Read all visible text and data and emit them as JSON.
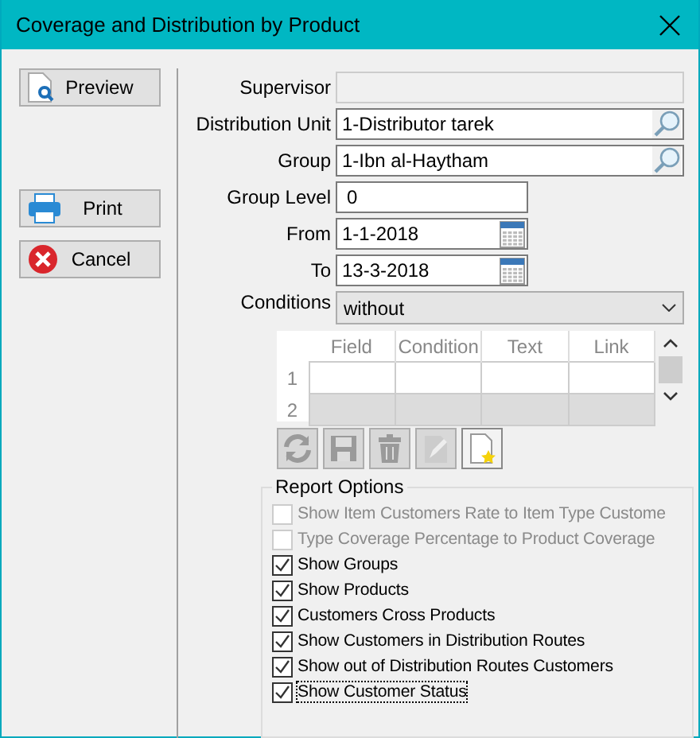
{
  "window": {
    "title": "Coverage and Distribution by Product"
  },
  "buttons": [
    {
      "label": "Preview",
      "kind": "preview"
    },
    {
      "label": "Print",
      "kind": "print"
    },
    {
      "label": "Cancel",
      "kind": "cancel"
    }
  ],
  "fields": [
    {
      "label": "Supervisor",
      "kind": "disabled"
    },
    {
      "label": "Distribution Unit",
      "value": "1-Distributor tarek",
      "kind": "lookup"
    },
    {
      "label": "Group",
      "value": "1-Ibn al-Haytham",
      "kind": "lookup"
    },
    {
      "label": "Group Level",
      "value": "0",
      "kind": "short"
    },
    {
      "label": "From",
      "value": "1-1-2018",
      "kind": "date"
    },
    {
      "label": "To",
      "value": "13-3-2018",
      "kind": "date"
    }
  ],
  "conditions": {
    "label": "Conditions",
    "value": "without"
  },
  "grid": {
    "columns": [
      "Field",
      "Condition",
      "Text",
      "Link"
    ],
    "rows": [
      {
        "number": "1",
        "disabled": false
      },
      {
        "number": "2",
        "disabled": true
      }
    ]
  },
  "toolbar": [
    {
      "kind": "refresh",
      "disabled": true
    },
    {
      "kind": "save",
      "disabled": true
    },
    {
      "kind": "delete",
      "disabled": true
    },
    {
      "kind": "edit",
      "disabled": true
    },
    {
      "kind": "new",
      "disabled": false
    }
  ],
  "report_options": {
    "title": "Report Options",
    "items": [
      {
        "label": "Show Item Customers Rate to Item Type Custome",
        "checked": false,
        "disabled": true,
        "focused": false
      },
      {
        "label": "Type Coverage Percentage to Product Coverage",
        "checked": false,
        "disabled": true,
        "focused": false
      },
      {
        "label": "Show Groups",
        "checked": true,
        "disabled": false,
        "focused": false
      },
      {
        "label": "Show Products",
        "checked": true,
        "disabled": false,
        "focused": false
      },
      {
        "label": "Customers Cross Products",
        "checked": true,
        "disabled": false,
        "focused": false
      },
      {
        "label": "Show Customers in Distribution Routes",
        "checked": true,
        "disabled": false,
        "focused": false
      },
      {
        "label": "Show out of Distribution Routes Customers",
        "checked": true,
        "disabled": false,
        "focused": false
      },
      {
        "label": "Show Customer Status",
        "checked": true,
        "disabled": false,
        "focused": true
      }
    ]
  }
}
